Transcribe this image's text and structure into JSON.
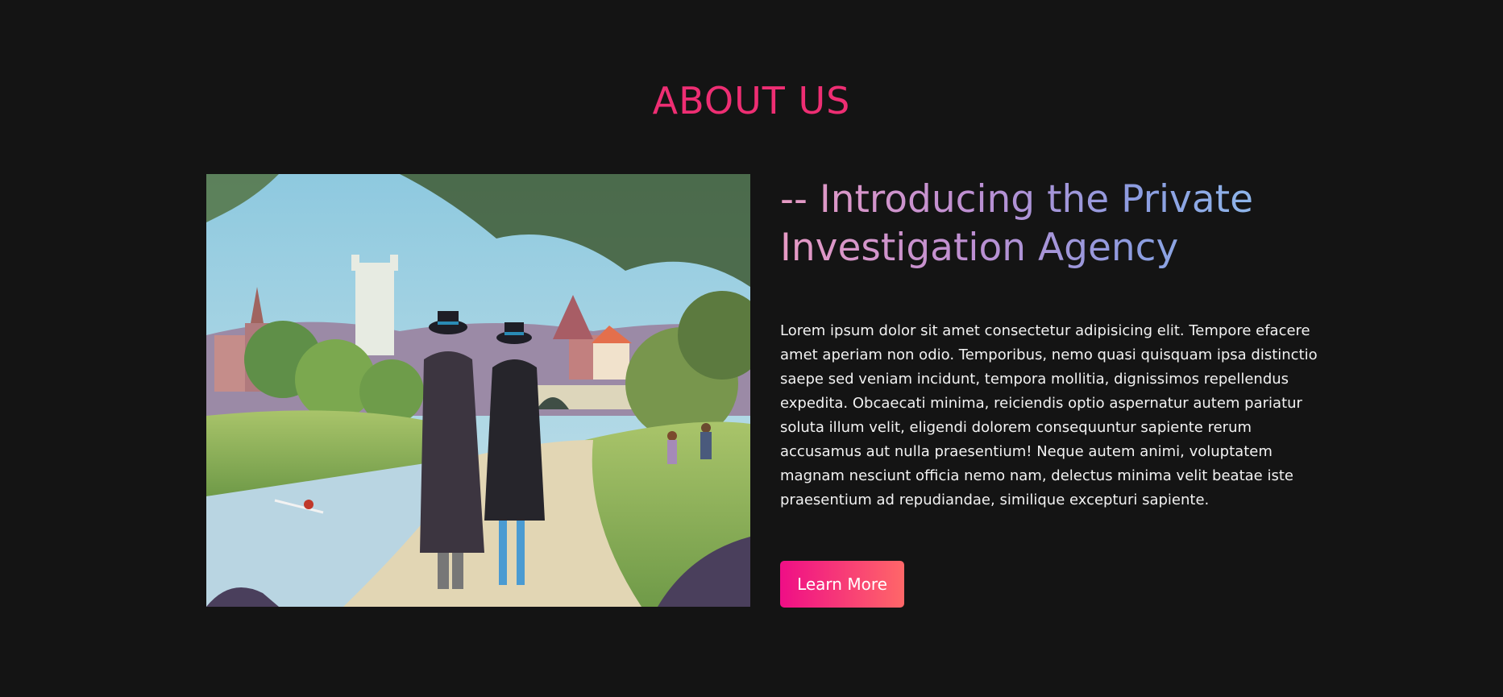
{
  "section": {
    "title": "ABOUT US"
  },
  "about": {
    "headline": "-- Introducing the Private Investigation Agency",
    "body": "Lorem ipsum dolor sit amet consectetur adipisicing elit. Tempore efacere amet aperiam non odio. Temporibus, nemo quasi quisquam ipsa distinctio saepe sed veniam incidunt, tempora mollitia, dignissimos repellendus expedita. Obcaecati minima, reiciendis optio aspernatur autem pariatur soluta illum velit, eligendi dolorem consequuntur sapiente rerum accusamus aut nulla praesentium! Neque autem animi, voluptatem magnam nesciunt officia nemo nam, delectus minima velit beatae iste praesentium ad repudiandae, similique excepturi sapiente.",
    "button_label": "Learn More"
  },
  "colors": {
    "background": "#141414",
    "title": "#ee2e73",
    "button_start": "#ef0e86",
    "button_end": "#ff6768"
  }
}
